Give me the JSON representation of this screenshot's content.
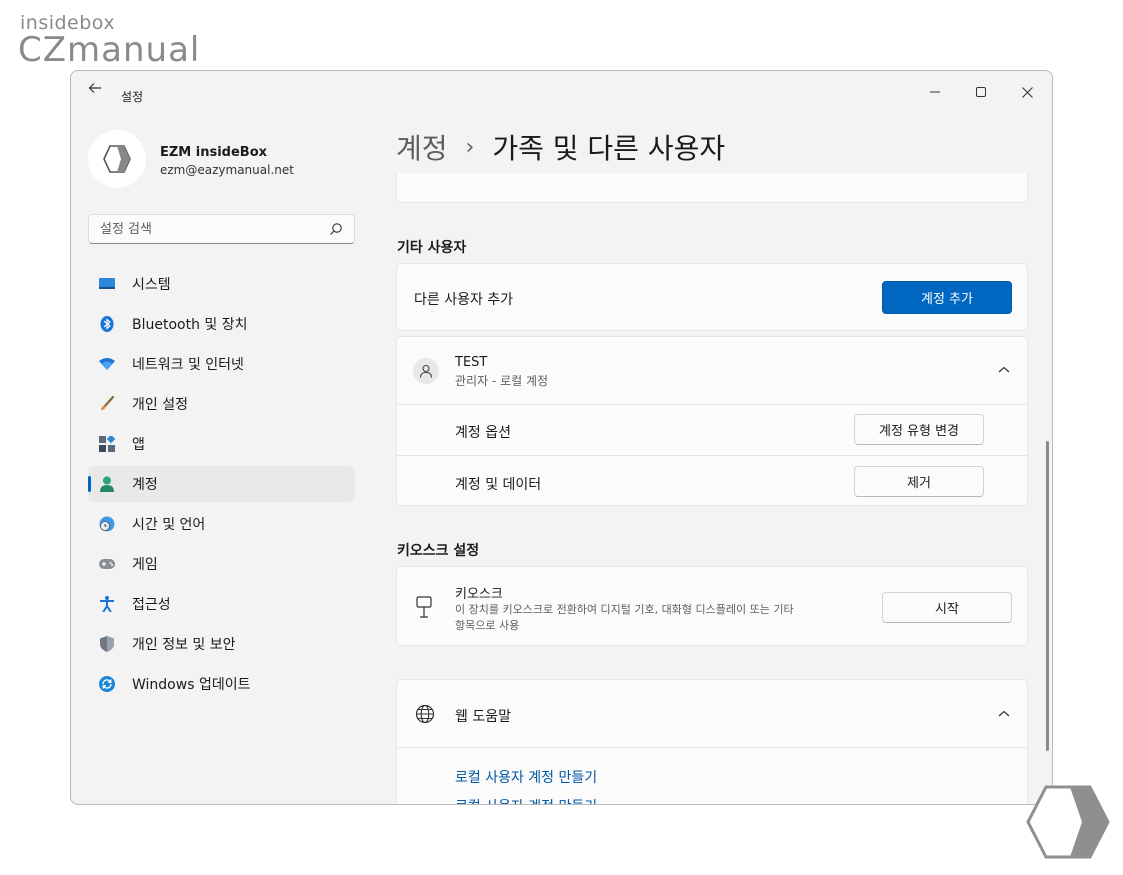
{
  "watermark": {
    "top": "insidebox",
    "main": "CZmanual"
  },
  "window": {
    "title": "설정"
  },
  "profile": {
    "name": "EZM insideBox",
    "email": "ezm@eazymanual.net"
  },
  "search": {
    "placeholder": "설정 검색"
  },
  "sidebar": {
    "items": [
      {
        "label": "시스템",
        "icon": "system-icon"
      },
      {
        "label": "Bluetooth 및 장치",
        "icon": "bluetooth-icon"
      },
      {
        "label": "네트워크 및 인터넷",
        "icon": "wifi-icon"
      },
      {
        "label": "개인 설정",
        "icon": "brush-icon"
      },
      {
        "label": "앱",
        "icon": "apps-icon"
      },
      {
        "label": "계정",
        "icon": "account-icon",
        "active": true
      },
      {
        "label": "시간 및 언어",
        "icon": "clock-globe-icon"
      },
      {
        "label": "게임",
        "icon": "gamepad-icon"
      },
      {
        "label": "접근성",
        "icon": "accessibility-icon"
      },
      {
        "label": "개인 정보 및 보안",
        "icon": "shield-icon"
      },
      {
        "label": "Windows 업데이트",
        "icon": "update-icon"
      }
    ]
  },
  "breadcrumb": {
    "parent": "계정",
    "separator": "›",
    "current": "가족 및 다른 사용자"
  },
  "other_users": {
    "heading": "기타 사용자",
    "add_label": "다른 사용자 추가",
    "add_button": "계정 추가",
    "user": {
      "name": "TEST",
      "role": "관리자 - 로컬 계정",
      "options_label": "계정 옵션",
      "change_type_button": "계정 유형 변경",
      "data_label": "계정 및 데이터",
      "remove_button": "제거"
    }
  },
  "kiosk": {
    "heading": "키오스크 설정",
    "title": "키오스크",
    "description_line1": "이 장치를 키오스크로 전환하여 디지털 기호, 대화형 디스플레이 또는 기타",
    "description_line2": "항목으로 사용",
    "start_button": "시작"
  },
  "web_help": {
    "title": "웹 도움말",
    "links": [
      "로컬 사용자 계정 만들기",
      "로컬 사용자 계정 만들기"
    ]
  },
  "colors": {
    "accent": "#0067c0",
    "window_bg": "#f3f3f3",
    "card_bg": "#fbfbfb"
  }
}
